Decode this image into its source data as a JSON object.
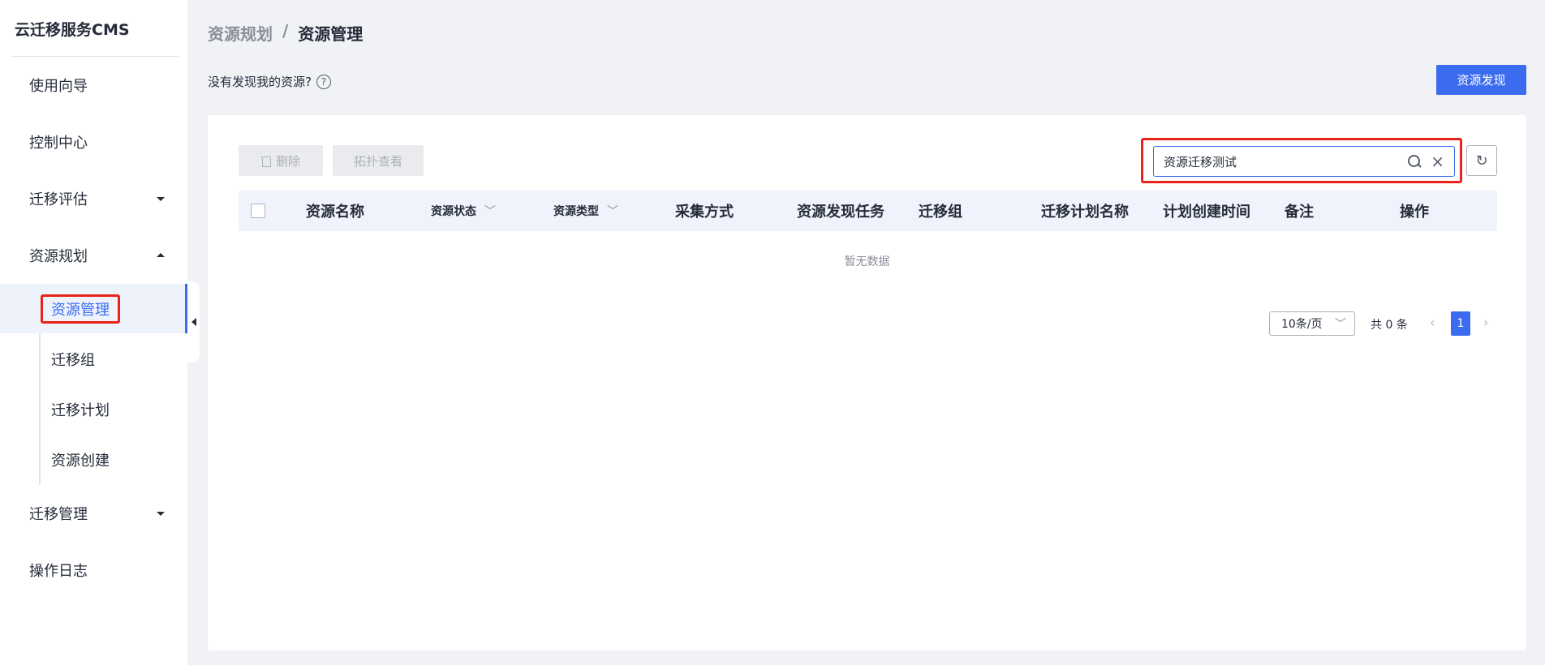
{
  "sidebar": {
    "brand": "云迁移服务CMS",
    "items": [
      {
        "label": "使用向导"
      },
      {
        "label": "控制中心"
      },
      {
        "label": "迁移评估"
      },
      {
        "label": "资源规划"
      },
      {
        "label": "迁移管理"
      },
      {
        "label": "操作日志"
      }
    ],
    "subitems": [
      {
        "label": "资源管理",
        "active": true
      },
      {
        "label": "迁移组"
      },
      {
        "label": "迁移计划"
      },
      {
        "label": "资源创建"
      }
    ]
  },
  "breadcrumb": {
    "parent": "资源规划",
    "separator": "/",
    "current": "资源管理"
  },
  "hint": {
    "text": "没有发现我的资源?",
    "icon": "?"
  },
  "actions": {
    "discover": "资源发现",
    "delete": "删除",
    "topology": "拓扑查看"
  },
  "search": {
    "value": "资源迁移测试",
    "clear": "×",
    "refresh": "↻"
  },
  "table": {
    "columns": [
      {
        "label": "资源名称"
      },
      {
        "label": "资源状态",
        "sortable": true
      },
      {
        "label": "资源类型",
        "sortable": true
      },
      {
        "label": "采集方式"
      },
      {
        "label": "资源发现任务"
      },
      {
        "label": "迁移组"
      },
      {
        "label": "迁移计划名称"
      },
      {
        "label": "计划创建时间"
      },
      {
        "label": "备注"
      },
      {
        "label": "操作"
      }
    ],
    "sort_glyph": "﹀",
    "empty_text": "暂无数据"
  },
  "pagination": {
    "page_size": "10条/页",
    "dropdown_glyph": "﹀",
    "total": "共 0 条",
    "prev": "‹",
    "next": "›",
    "current_page": "1"
  },
  "colors": {
    "primary": "#3b6cf0",
    "highlight": "#e8231c"
  }
}
